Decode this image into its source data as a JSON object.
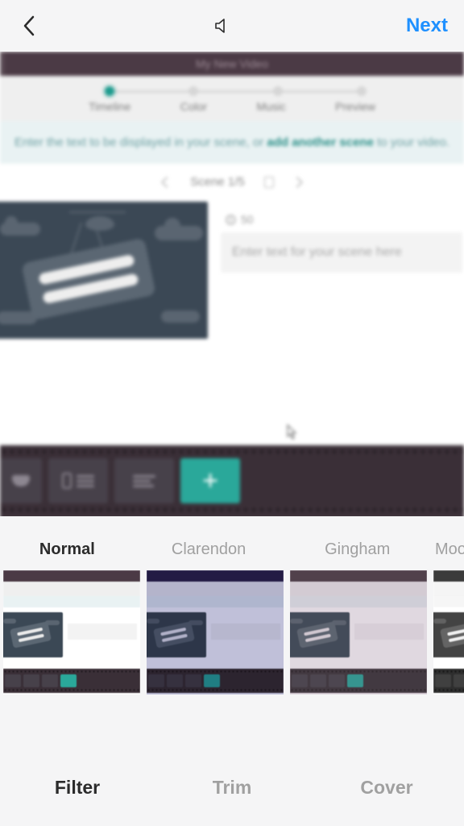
{
  "nav": {
    "next_label": "Next"
  },
  "editor": {
    "title": "My New Video",
    "steps": {
      "timeline": "Timeline",
      "color": "Color",
      "music": "Music",
      "preview": "Preview"
    },
    "hint_pre": "Enter the text to be displayed in your scene, or ",
    "hint_emph": "add another scene",
    "hint_post": " to your video.",
    "scene_label": "Scene 1/5",
    "char_limit": "50",
    "input_placeholder": "Enter text for your scene here"
  },
  "filters": {
    "items": [
      {
        "label": "Normal"
      },
      {
        "label": "Clarendon"
      },
      {
        "label": "Gingham"
      },
      {
        "label": "Moon"
      }
    ]
  },
  "tabs": {
    "filter": "Filter",
    "trim": "Trim",
    "cover": "Cover"
  }
}
